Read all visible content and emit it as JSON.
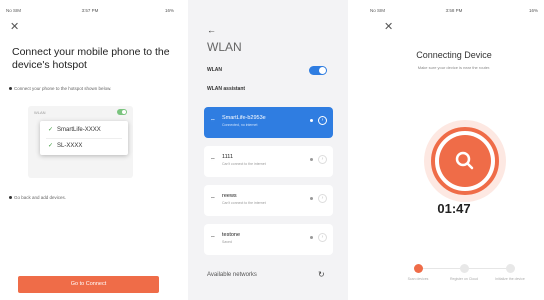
{
  "screen1": {
    "status": {
      "carrier": "No SIM",
      "time": "3:57 PM",
      "battery": "16%"
    },
    "title": "Connect your mobile phone to the device's hotspot",
    "bullet1": "Connect your phone to the hotspot shown below.",
    "mock_wlan_label": "WLAN",
    "hotspots": [
      "SmartLife-XXXX",
      "SL-XXXX"
    ],
    "bullet2": "Go back and add devices.",
    "button": "Go to Connect",
    "accent": "#ef6c48"
  },
  "screen2": {
    "back": "←",
    "title": "WLAN",
    "wlan_label": "WLAN",
    "assistant_label": "WLAN assistant",
    "networks": [
      {
        "name": "SmartLife-b2953e",
        "sub": "Connected, no internet",
        "active": true
      },
      {
        "name": "1111",
        "sub": "Can't connect to the internet",
        "active": false
      },
      {
        "name": "reews",
        "sub": "Can't connect to the internet",
        "active": false
      },
      {
        "name": "testone",
        "sub": "Saved",
        "active": false
      }
    ],
    "available": "Available networks",
    "accent": "#2f7de1"
  },
  "screen3": {
    "status": {
      "carrier": "No SIM",
      "time": "3:58 PM",
      "battery": "16%"
    },
    "title": "Connecting Device",
    "subtitle": "Make sure your device is near the router.",
    "timer": "01:47",
    "steps": [
      "Scan devices",
      "Register on Cloud",
      "Initialize the device"
    ]
  }
}
